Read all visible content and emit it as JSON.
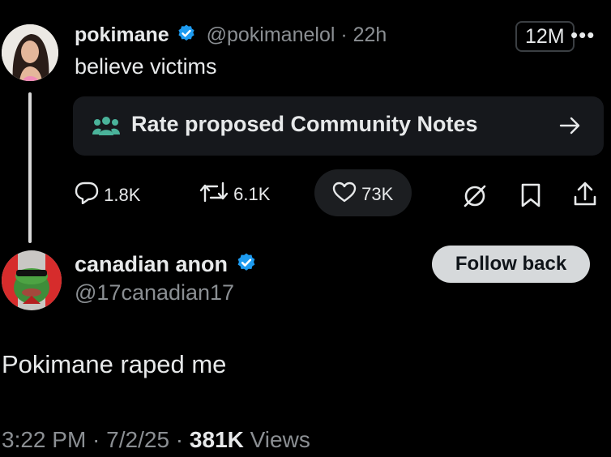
{
  "original_post": {
    "author_name": "pokimane",
    "handle": "@pokimanelol",
    "time": "22h",
    "text": "believe victims",
    "views_badge": "12M",
    "community_notes_label": "Rate proposed Community Notes",
    "actions": {
      "replies": "1.8K",
      "reposts": "6.1K",
      "likes": "73K"
    }
  },
  "reply": {
    "author_name": "canadian anon",
    "handle": "@17canadian17",
    "follow_label": "Follow back",
    "text": "Pokimane raped me",
    "time": "3:22 PM",
    "date": "7/2/25",
    "views_count": "381K",
    "views_label": "Views"
  },
  "colors": {
    "background": "#000000",
    "verified": "#1d9bf0",
    "community_notes_icon": "#4ab39a",
    "muted_text": "#8b8f93"
  },
  "icons": [
    "verified-icon",
    "more-icon",
    "community-notes-icon",
    "arrow-right-icon",
    "reply-icon",
    "repost-icon",
    "like-icon",
    "grok-icon",
    "bookmark-icon",
    "share-icon"
  ]
}
